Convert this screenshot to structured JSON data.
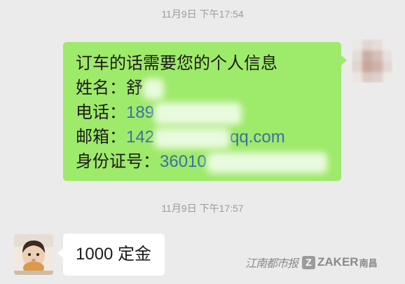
{
  "colors": {
    "chat_background": "#ebebeb",
    "sent_bubble": "#9eea6a",
    "received_bubble": "#ffffff",
    "link_text": "#3c6fa6",
    "timestamp_text": "#9b9b9b"
  },
  "timestamps": [
    "11月9日 下午17:54",
    "11月9日 下午17:57"
  ],
  "sent_message": {
    "intro": "订车的话需要您的个人信息",
    "name": {
      "label": "姓名：",
      "value": "舒"
    },
    "phone": {
      "label": "电话：",
      "value": "189"
    },
    "email": {
      "label": "邮箱：",
      "value_start": "142",
      "value_end": "qq.com"
    },
    "id_card": {
      "label": "身份证号：",
      "value": "36010"
    }
  },
  "received_message": {
    "text": "1000 定金"
  },
  "watermark": {
    "newspaper": "江南都市报",
    "logo_letter": "Z",
    "brand": "ZAKER",
    "city": "南昌"
  }
}
